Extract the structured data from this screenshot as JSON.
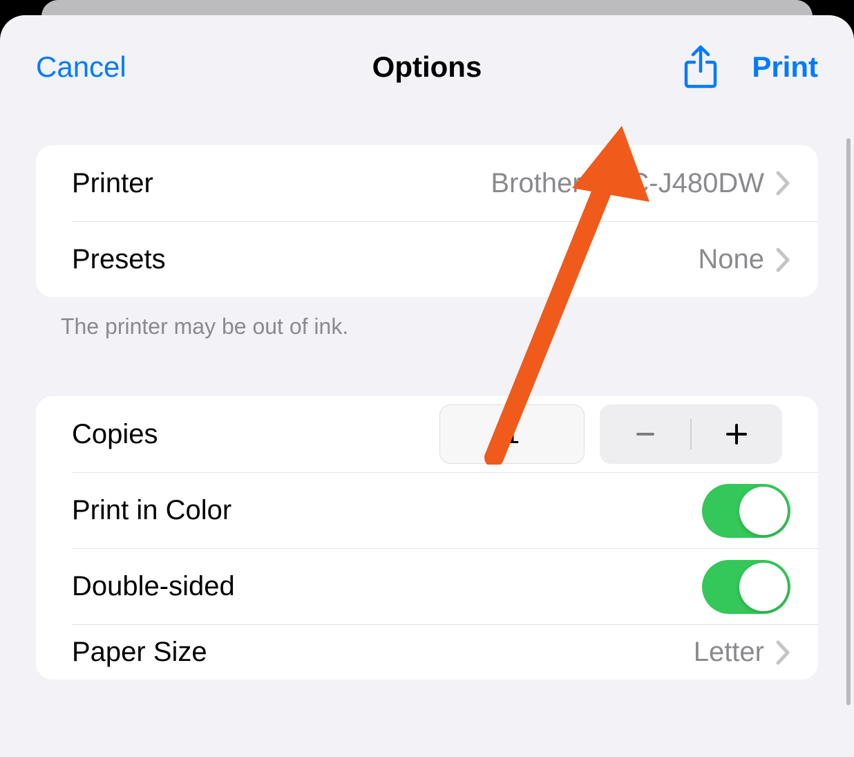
{
  "header": {
    "cancel": "Cancel",
    "title": "Options",
    "print": "Print"
  },
  "printer_group": {
    "printer_label": "Printer",
    "printer_value": "Brother MFC-J480DW",
    "presets_label": "Presets",
    "presets_value": "None"
  },
  "status_note": "The printer may be out of ink.",
  "options_group": {
    "copies_label": "Copies",
    "copies_value": "1",
    "print_color_label": "Print in Color",
    "print_color_on": true,
    "double_sided_label": "Double-sided",
    "double_sided_on": true,
    "paper_size_label": "Paper Size",
    "paper_size_value": "Letter"
  },
  "colors": {
    "accent": "#007aff",
    "toggle_on": "#34c759",
    "annotation": "#f05a1a"
  }
}
